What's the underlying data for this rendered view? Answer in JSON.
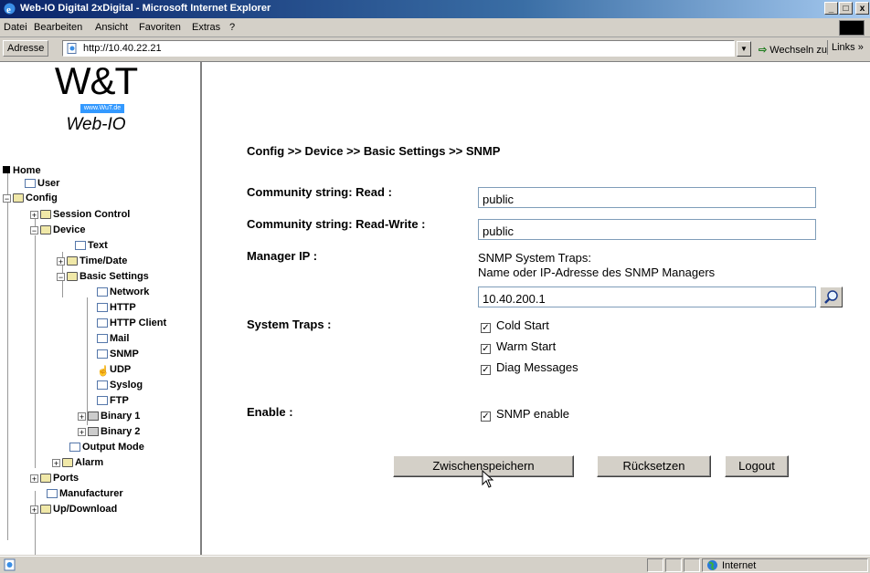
{
  "window": {
    "title": "Web-IO Digital 2xDigital - Microsoft Internet Explorer",
    "minimize": "_",
    "maximize": "□",
    "close": "x"
  },
  "menu": [
    "Datei",
    "Bearbeiten",
    "Ansicht",
    "Favoriten",
    "Extras",
    "?"
  ],
  "address": {
    "label": "Adresse",
    "url": "http://10.40.22.21",
    "go": "Wechseln zu",
    "links": "Links »"
  },
  "logo": {
    "brand": "W&T",
    "url": "www.WuT.de",
    "product": "Web-IO"
  },
  "tree": {
    "home": "Home",
    "user": "User",
    "config": "Config",
    "session_control": "Session Control",
    "device": "Device",
    "text": "Text",
    "time_date": "Time/Date",
    "basic_settings": "Basic Settings",
    "network": "Network",
    "http": "HTTP",
    "http_client": "HTTP Client",
    "mail": "Mail",
    "snmp": "SNMP",
    "udp": "UDP",
    "syslog": "Syslog",
    "ftp": "FTP",
    "binary1": "Binary 1",
    "binary2": "Binary 2",
    "output_mode": "Output Mode",
    "alarm": "Alarm",
    "ports": "Ports",
    "manufacturer": "Manufacturer",
    "up_download": "Up/Download"
  },
  "form": {
    "breadcrumb": "Config >> Device >> Basic Settings >> SNMP",
    "community_read_label": "Community string: Read :",
    "community_read_value": "public",
    "community_rw_label": "Community string: Read-Write :",
    "community_rw_value": "public",
    "manager_ip_label": "Manager IP :",
    "manager_note_1": "SNMP System Traps:",
    "manager_note_2": "Name oder IP-Adresse des SNMP Managers",
    "manager_ip_value": "10.40.200.1",
    "system_traps_label": "System Traps :",
    "traps": [
      {
        "label": "Cold Start",
        "checked": true
      },
      {
        "label": "Warm Start",
        "checked": true
      },
      {
        "label": "Diag Messages",
        "checked": true
      }
    ],
    "enable_label": "Enable :",
    "snmp_enable": {
      "label": "SNMP enable",
      "checked": true
    },
    "check_mark": "☑"
  },
  "buttons": {
    "save": "Zwischenspeichern",
    "reset": "Rücksetzen",
    "logout": "Logout"
  },
  "status": {
    "zone": "Internet"
  },
  "icons": [
    "ie-icon",
    "search-icon",
    "page-icon",
    "globe-icon",
    "hand-cursor-icon",
    "arrow-cursor-icon",
    "folder-icon",
    "document-icon"
  ]
}
